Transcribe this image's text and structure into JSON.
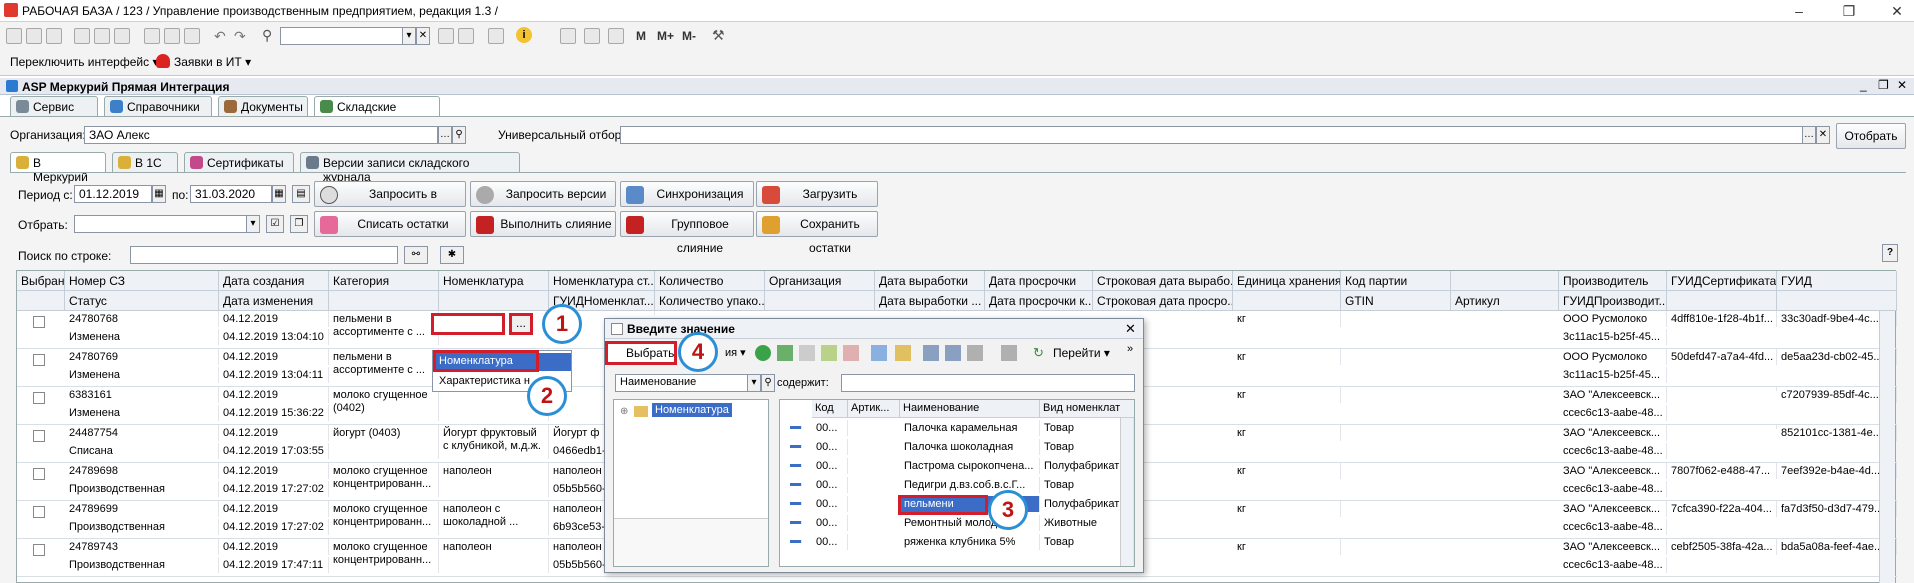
{
  "window": {
    "title": "РАБОЧАЯ БАЗА / 123 /  Управление производственным предприятием, редакция 1.3 /"
  },
  "toolbar": {
    "switch_interface": "Переключить интерфейс",
    "requests_it": "Заявки в ИТ",
    "m": "M",
    "mplus": "M+",
    "mminus": "M-"
  },
  "panel": {
    "title": "ASP Меркурий Прямая Интеграция"
  },
  "main_tabs": [
    "Сервис",
    "Справочники",
    "Документы",
    "Складские записи"
  ],
  "filters": {
    "org_label": "Организация:",
    "org_value": "ЗАО  Алекс",
    "universal_label": "Универсальный отбор:",
    "select_button": "Отобрать"
  },
  "sub_tabs": [
    "В Меркурий",
    "В 1С",
    "Сертификаты",
    "Версии записи складского журнала"
  ],
  "period": {
    "label": "Период с:",
    "from": "01.12.2019",
    "to_label": "по:",
    "to": "31.03.2020"
  },
  "select_label": "Отбрать:",
  "search_label": "Поиск по строке:",
  "help": "?",
  "buttons": {
    "request_mercury": "Запросить в Меркурий",
    "request_versions": "Запросить версии СЗ",
    "sync": "Синхронизация",
    "load_goods": "Загрузить товары",
    "write_off": "Списать остатки",
    "merge": "Выполнить слияние",
    "group_merge": "Групповое слияние",
    "save_rest": "Сохранить остатки"
  },
  "columns_top": [
    "Выбран",
    "Номер СЗ",
    "Дата создания",
    "Категория",
    "Номенклатура",
    "Номенклатура ст...",
    "Количество",
    "Организация",
    "Дата выработки",
    "Дата просрочки",
    "Строковая дата вырабо...",
    "Единица хранения",
    "Код партии",
    "",
    "Производитель",
    "ГУИДСертификата",
    "ГУИД"
  ],
  "columns_bottom": [
    "",
    "Статус",
    "Дата изменения",
    "",
    "",
    "ГУИДНоменклат...",
    "Количество упако...",
    "",
    "Дата выработки ...",
    "Дата просрочки к...",
    "Строковая дата просро...",
    "",
    "GTIN",
    "Артикул",
    "ГУИДПроизводит...",
    "",
    ""
  ],
  "rows": [
    {
      "num": "24780768",
      "status": "Изменена",
      "created": "04.12.2019",
      "changed": "04.12.2019 13:04:10",
      "cat": "пельмени в ассортименте с ...",
      "nom": "",
      "nom2": "",
      "unit": "кг",
      "prod": "ООО Русмолоко",
      "prod2": "3c11ac15-b25f-45...",
      "cert": "4dff810e-1f28-4b1f...",
      "guid": "33c30adf-9be4-4c..."
    },
    {
      "num": "24780769",
      "status": "Изменена",
      "created": "04.12.2019",
      "changed": "04.12.2019 13:04:11",
      "cat": "пельмени в ассортименте с ...",
      "nom": "",
      "nom2": "",
      "unit": "кг",
      "prod": "ООО Русмолоко",
      "prod2": "3c11ac15-b25f-45...",
      "cert": "50defd47-a7a4-4fd...",
      "guid": "de5aa23d-cb02-45..."
    },
    {
      "num": "6383161",
      "status": "Изменена",
      "created": "04.12.2019",
      "changed": "04.12.2019 15:36:22",
      "cat": "молоко сгущенное (0402)",
      "nom": "",
      "nom2": "",
      "unit": "кг",
      "prod": "ЗАО \"Алексеевск...",
      "prod2": "ccec6c13-aabe-48...",
      "cert": "",
      "guid": "c7207939-85df-4c..."
    },
    {
      "num": "24487754",
      "status": "Списана",
      "created": "04.12.2019",
      "changed": "04.12.2019 17:03:55",
      "cat": "йогурт (0403)",
      "nom": "Йогурт фруктовый с клубникой, м.д.ж.",
      "nom2": "Йогурт ф",
      "unit": "кг",
      "prod": "ЗАО \"Алексеевск...",
      "prod2": "ccec6c13-aabe-48...",
      "cert": "",
      "guid": "852101cc-1381-4e..."
    },
    {
      "num": "24789698",
      "status": "Производственная",
      "created": "04.12.2019",
      "changed": "04.12.2019 17:27:02",
      "cat": "молоко сгущенное концентрированн...",
      "nom": "наполеон",
      "nom2": "наполеон",
      "unit": "кг",
      "prod": "ЗАО \"Алексеевск...",
      "prod2": "ccec6c13-aabe-48...",
      "cert": "7807f062-e488-47...",
      "guid": "7eef392e-b4ae-4d..."
    },
    {
      "num": "24789699",
      "status": "Производственная",
      "created": "04.12.2019",
      "changed": "04.12.2019 17:27:02",
      "cat": "молоко сгущенное концентрированн...",
      "nom": "наполеон  с шоколадной ...",
      "nom2": "наполеон",
      "unit": "кг",
      "prod": "ЗАО \"Алексеевск...",
      "prod2": "ccec6c13-aabe-48...",
      "cert": "7cfca390-f22a-404...",
      "guid": "fa7d3f50-d3d7-479..."
    },
    {
      "num": "24789743",
      "status": "Производственная",
      "created": "04.12.2019",
      "changed": "04.12.2019 17:47:11",
      "cat": "молоко сгущенное концентрированн...",
      "nom": "наполеон",
      "nom2": "наполеон",
      "unit": "кг",
      "prod": "ЗАО \"Алексеевск...",
      "prod2": "ccec6c13-aabe-48...",
      "cert": "cebf2505-38fa-42a...",
      "guid": "bda5a08a-feef-4ae..."
    }
  ],
  "extra_cells": {
    "r4_nom2b": "0466edb1-",
    "r5_nom2b": "05b5b560-",
    "r6_nom2b": "6b93ce53-",
    "r7_nom2b": "05b5b560-"
  },
  "popup_menu": {
    "item1": "Номенклатура",
    "item2": "Характеристика н"
  },
  "dialog": {
    "title": "Введите значение",
    "choose": "Выбрать",
    "actions": "ия",
    "goto": "Перейти",
    "field": "Наименование",
    "contains": "содержит:",
    "tree_root": "Номенклатура",
    "cols": [
      "Код",
      "Артик...",
      "Наименование",
      "Вид номенклат"
    ],
    "items": [
      {
        "code": "00...",
        "name": "Палочка карамельная",
        "kind": "Товар"
      },
      {
        "code": "00...",
        "name": "Палочка шоколадная",
        "kind": "Товар"
      },
      {
        "code": "00...",
        "name": "Пастрома сырокопчена...",
        "kind": "Полуфабрикат"
      },
      {
        "code": "00...",
        "name": "Педигри д.вз.соб.в.с.Г...",
        "kind": "Товар"
      },
      {
        "code": "00...",
        "name": "пельмени",
        "kind": "Полуфабрикат"
      },
      {
        "code": "00...",
        "name": "Ремонтный молод...",
        "kind": "Животные"
      },
      {
        "code": "00...",
        "name": "ряженка клубника 5%",
        "kind": "Товар"
      }
    ]
  },
  "markers": [
    "1",
    "2",
    "3",
    "4"
  ],
  "ellipsis": "..."
}
